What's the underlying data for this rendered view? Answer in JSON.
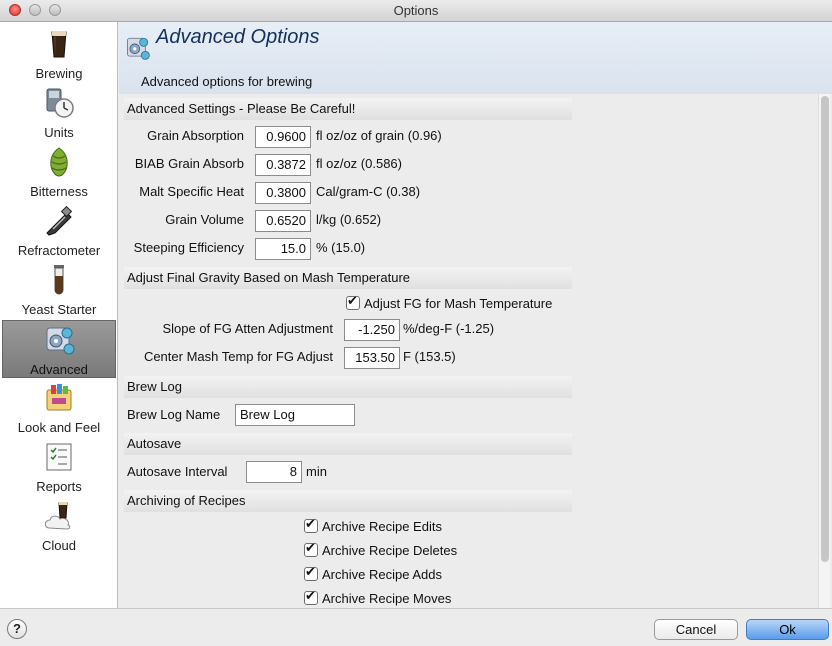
{
  "window": {
    "title": "Options"
  },
  "sidebar": {
    "items": [
      {
        "label": "Brewing",
        "icon": "beer-glass-icon"
      },
      {
        "label": "Units",
        "icon": "units-clock-icon"
      },
      {
        "label": "Bitterness",
        "icon": "hop-icon"
      },
      {
        "label": "Refractometer",
        "icon": "refractometer-icon"
      },
      {
        "label": "Yeast Starter",
        "icon": "test-tube-icon"
      },
      {
        "label": "Advanced",
        "icon": "advanced-gear-icon",
        "active": true
      },
      {
        "label": "Look and Feel",
        "icon": "paint-palette-icon"
      },
      {
        "label": "Reports",
        "icon": "checklist-icon"
      },
      {
        "label": "Cloud",
        "icon": "cloud-icon"
      }
    ]
  },
  "header": {
    "title": "Advanced Options",
    "subtitle": "Advanced options for brewing"
  },
  "sections": {
    "advanced": "Advanced Settings - Please Be Careful!",
    "fg": "Adjust Final Gravity Based on Mash Temperature",
    "brew_log": "Brew Log",
    "autosave": "Autosave",
    "archiving": "Archiving of Recipes"
  },
  "advanced": {
    "grain_absorption": {
      "label": "Grain Absorption",
      "value": "0.9600",
      "unit": "fl oz/oz of grain (0.96)"
    },
    "biab_grain_absorb": {
      "label": "BIAB Grain Absorb",
      "value": "0.3872",
      "unit": "fl oz/oz (0.586)"
    },
    "malt_specific_heat": {
      "label": "Malt Specific Heat",
      "value": "0.3800",
      "unit": "Cal/gram-C (0.38)"
    },
    "grain_volume": {
      "label": "Grain Volume",
      "value": "0.6520",
      "unit": "l/kg (0.652)"
    },
    "steeping_efficiency": {
      "label": "Steeping Efficiency",
      "value": "15.0",
      "unit": "% (15.0)"
    }
  },
  "fg": {
    "adjust_checkbox": {
      "label": "Adjust FG for Mash Temperature",
      "checked": true
    },
    "slope": {
      "label": "Slope of FG Atten Adjustment",
      "value": "-1.250",
      "unit": "%/deg-F (-1.25)"
    },
    "center_temp": {
      "label": "Center Mash Temp for FG Adjust",
      "value": "153.50",
      "unit": "F (153.5)"
    }
  },
  "brew_log": {
    "label": "Brew Log Name",
    "value": "Brew Log"
  },
  "autosave": {
    "label": "Autosave Interval",
    "value": "8",
    "unit": "min"
  },
  "archiving": {
    "edits": {
      "label": "Archive Recipe Edits",
      "checked": true
    },
    "deletes": {
      "label": "Archive Recipe Deletes",
      "checked": true
    },
    "adds": {
      "label": "Archive Recipe Adds",
      "checked": true
    },
    "moves": {
      "label": "Archive Recipe Moves",
      "checked": true
    }
  },
  "footer": {
    "help": "?",
    "cancel": "Cancel",
    "ok": "Ok"
  }
}
